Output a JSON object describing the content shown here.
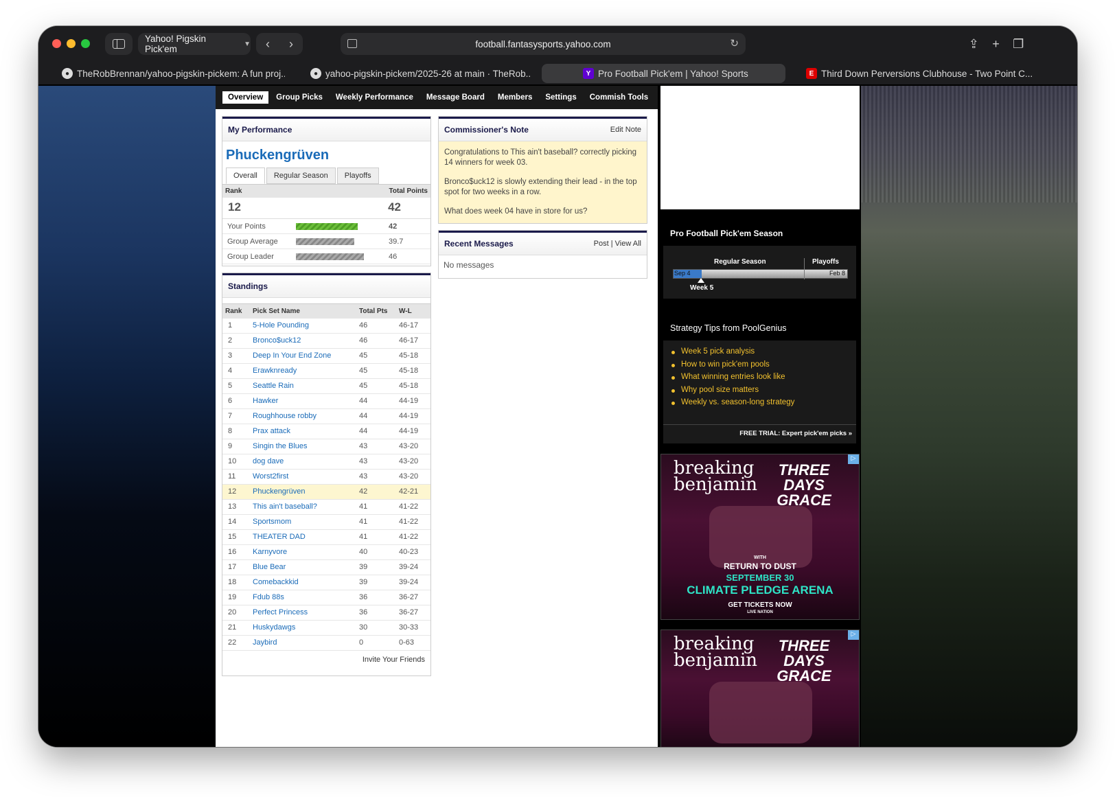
{
  "browser": {
    "tab_group_label": "Yahoo! Pigskin Pick'em",
    "url": "football.fantasysports.yahoo.com",
    "tabs": [
      {
        "label": "TheRobBrennan/yahoo-pigskin-pickem: A fun proj...",
        "active": false
      },
      {
        "label": "yahoo-pigskin-pickem/2025-26 at main · TheRob...",
        "active": false
      },
      {
        "label": "Pro Football Pick'em | Yahoo! Sports",
        "active": true
      },
      {
        "label": "Third Down Perversions Clubhouse - Two Point C...",
        "active": false
      }
    ]
  },
  "nav": {
    "items": [
      "Overview",
      "Group Picks",
      "Weekly Performance",
      "Message Board",
      "Members",
      "Settings",
      "Commish Tools"
    ],
    "active": "Overview"
  },
  "performance": {
    "title": "My Performance",
    "team_name": "Phuckengrüven",
    "tabs": [
      "Overall",
      "Regular Season",
      "Playoffs"
    ],
    "active_tab": "Overall",
    "rank_label": "Rank",
    "total_points_label": "Total Points",
    "rank": "12",
    "total_points": "42",
    "rows": [
      {
        "label": "Your Points",
        "value": "42",
        "fraction": 1.0,
        "color": "green"
      },
      {
        "label": "Group Average",
        "value": "39.7",
        "fraction": 0.945,
        "color": "gray"
      },
      {
        "label": "Group Leader",
        "value": "46",
        "fraction": 1.095,
        "color": "gray"
      }
    ]
  },
  "standings": {
    "title": "Standings",
    "columns": [
      "Rank",
      "Pick Set Name",
      "Total Pts",
      "W-L"
    ],
    "rows": [
      {
        "rank": "1",
        "name": "5-Hole Pounding",
        "pts": "46",
        "wl": "46-17"
      },
      {
        "rank": "2",
        "name": "Bronco$uck12",
        "pts": "46",
        "wl": "46-17"
      },
      {
        "rank": "3",
        "name": "Deep In Your End Zone",
        "pts": "45",
        "wl": "45-18"
      },
      {
        "rank": "4",
        "name": "Erawknready",
        "pts": "45",
        "wl": "45-18"
      },
      {
        "rank": "5",
        "name": "Seattle Rain",
        "pts": "45",
        "wl": "45-18"
      },
      {
        "rank": "6",
        "name": "Hawker",
        "pts": "44",
        "wl": "44-19"
      },
      {
        "rank": "7",
        "name": "Roughhouse robby",
        "pts": "44",
        "wl": "44-19"
      },
      {
        "rank": "8",
        "name": "Prax attack",
        "pts": "44",
        "wl": "44-19"
      },
      {
        "rank": "9",
        "name": "Singin the Blues",
        "pts": "43",
        "wl": "43-20"
      },
      {
        "rank": "10",
        "name": "dog dave",
        "pts": "43",
        "wl": "43-20"
      },
      {
        "rank": "11",
        "name": "Worst2first",
        "pts": "43",
        "wl": "43-20"
      },
      {
        "rank": "12",
        "name": "Phuckengrüven",
        "pts": "42",
        "wl": "42-21",
        "highlight": true
      },
      {
        "rank": "13",
        "name": "This ain't baseball?",
        "pts": "41",
        "wl": "41-22"
      },
      {
        "rank": "14",
        "name": "Sportsmom",
        "pts": "41",
        "wl": "41-22"
      },
      {
        "rank": "15",
        "name": "THEATER DAD",
        "pts": "41",
        "wl": "41-22"
      },
      {
        "rank": "16",
        "name": "Karnyvore",
        "pts": "40",
        "wl": "40-23"
      },
      {
        "rank": "17",
        "name": "Blue Bear",
        "pts": "39",
        "wl": "39-24"
      },
      {
        "rank": "18",
        "name": "Comebackkid",
        "pts": "39",
        "wl": "39-24"
      },
      {
        "rank": "19",
        "name": "Fdub 88s",
        "pts": "36",
        "wl": "36-27"
      },
      {
        "rank": "20",
        "name": "Perfect Princess",
        "pts": "36",
        "wl": "36-27"
      },
      {
        "rank": "21",
        "name": "Huskydawgs",
        "pts": "30",
        "wl": "30-33"
      },
      {
        "rank": "22",
        "name": "Jaybird",
        "pts": "0",
        "wl": "0-63"
      }
    ],
    "invite_label": "Invite Your Friends"
  },
  "commissioner": {
    "title": "Commissioner's Note",
    "edit_label": "Edit Note",
    "paragraphs": [
      "Congratulations to This ain't baseball? correctly picking 14 winners for week 03.",
      "Bronco$uck12 is slowly extending their lead - in the top spot for two weeks in a row.",
      "What does week 04 have in store for us?"
    ]
  },
  "messages": {
    "title": "Recent Messages",
    "post_label": "Post",
    "view_all_label": "View All",
    "empty_text": "No messages"
  },
  "season": {
    "title": "Pro Football Pick'em Season",
    "regular_label": "Regular Season",
    "playoffs_label": "Playoffs",
    "start_label": "Sep 4",
    "end_label": "Feb 8",
    "current_week_label": "Week 5",
    "progress_fraction": 0.16
  },
  "tips": {
    "title": "Strategy Tips from PoolGenius",
    "items": [
      "Week 5 pick analysis",
      "How to win pick'em pools",
      "What winning entries look like",
      "Why pool size matters",
      "Weekly vs. season-long strategy"
    ],
    "footer": "FREE TRIAL: Expert pick'em picks »"
  },
  "ads": {
    "band1": "breaking benjamin",
    "band2": "THREE DAYS GRACE",
    "with": "WITH",
    "support": "RETURN TO DUST",
    "date": "SEPTEMBER 30",
    "venue": "CLIMATE PLEDGE ARENA",
    "cta": "GET TICKETS NOW",
    "sponsor": "LIVE NATION"
  },
  "colors": {
    "accent_blue": "#1a6bb8",
    "highlight_row": "#fdf6d0",
    "note_bg": "#fff5cc",
    "tips_link": "#f2c12e"
  }
}
